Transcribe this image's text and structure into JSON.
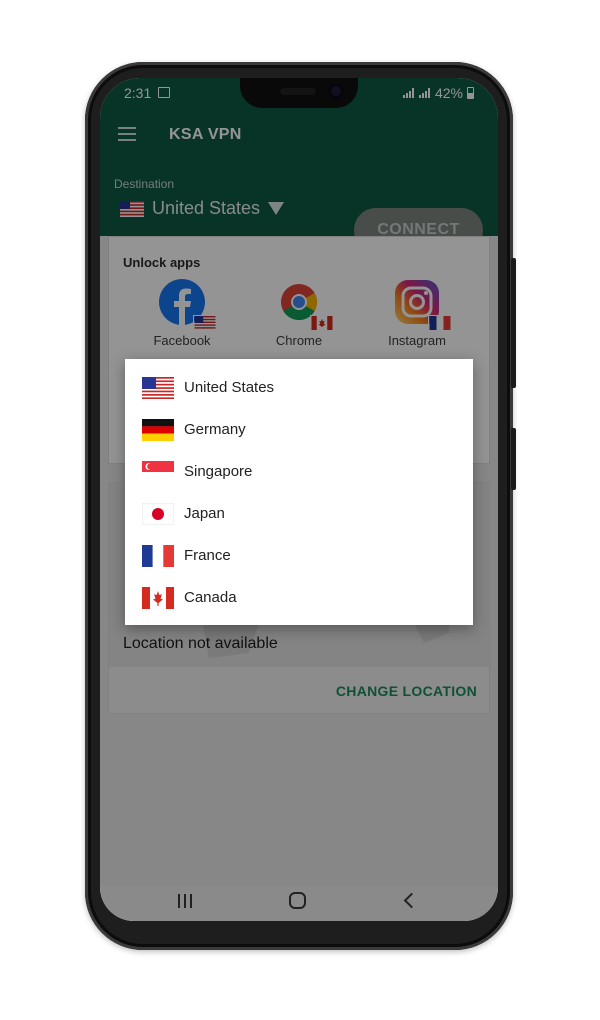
{
  "status_bar": {
    "time": "2:31",
    "battery": "42%"
  },
  "app": {
    "title": "KSA VPN"
  },
  "destination": {
    "label": "Destination",
    "value": "United States"
  },
  "connect_button": {
    "label": "CONNECT"
  },
  "unlock_apps": {
    "title": "Unlock apps",
    "apps": [
      {
        "label": "Facebook",
        "flag": "us"
      },
      {
        "label": "Chrome",
        "flag": "ca"
      },
      {
        "label": "Instagram",
        "flag": "fr"
      }
    ]
  },
  "location": {
    "status": "Location not available",
    "change_label": "CHANGE LOCATION"
  },
  "country_dialog": {
    "items": [
      {
        "label": "United States",
        "flag": "us"
      },
      {
        "label": "Germany",
        "flag": "de"
      },
      {
        "label": "Singapore",
        "flag": "sg"
      },
      {
        "label": "Japan",
        "flag": "jp"
      },
      {
        "label": "France",
        "flag": "fr"
      },
      {
        "label": "Canada",
        "flag": "ca"
      }
    ]
  },
  "colors": {
    "brand": "#0f5b45",
    "accent": "#1b8a5e"
  },
  "nav_icons": [
    "recent-apps-icon",
    "home-icon",
    "back-icon"
  ]
}
